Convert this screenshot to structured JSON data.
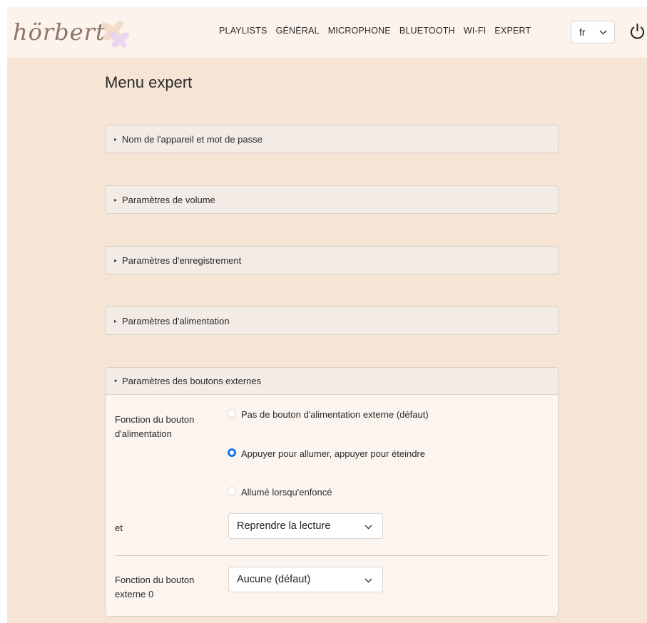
{
  "brand": {
    "logo_text": "hörbert"
  },
  "nav": {
    "items": [
      "PLAYLISTS",
      "GÉNÉRAL",
      "MICROPHONE",
      "BLUETOOTH",
      "WI-FI",
      "EXPERT"
    ],
    "language": "fr",
    "icons": {
      "power": "power-icon",
      "chevron": "chevron-down-icon",
      "logo_art": "butterfly-icon"
    }
  },
  "page": {
    "title": "Menu expert"
  },
  "sections": [
    {
      "label": "Nom de l'appareil et mot de passe",
      "expanded": false
    },
    {
      "label": "Paramètres de volume",
      "expanded": false
    },
    {
      "label": "Paramètres d'enregistrement",
      "expanded": false
    },
    {
      "label": "Paramètres d'alimentation",
      "expanded": false
    },
    {
      "label": "Paramètres des boutons externes",
      "expanded": true
    }
  ],
  "external_buttons": {
    "power_function_label": "Fonction du bouton d'alimentation",
    "options": [
      {
        "label": "Pas de bouton d'alimentation externe (défaut)",
        "selected": false
      },
      {
        "label": "Appuyer pour allumer, appuyer pour éteindre",
        "selected": true
      },
      {
        "label": "Allumé lorsqu'enfoncé",
        "selected": false
      }
    ],
    "and_label": "et",
    "and_value": "Reprendre la lecture",
    "ext0_label": "Fonction du bouton externe 0",
    "ext0_value": "Aucune (défaut)"
  },
  "colors": {
    "accent": "#1a73e8",
    "background": "#f6e4d4",
    "navbar": "#fbf3ec"
  }
}
